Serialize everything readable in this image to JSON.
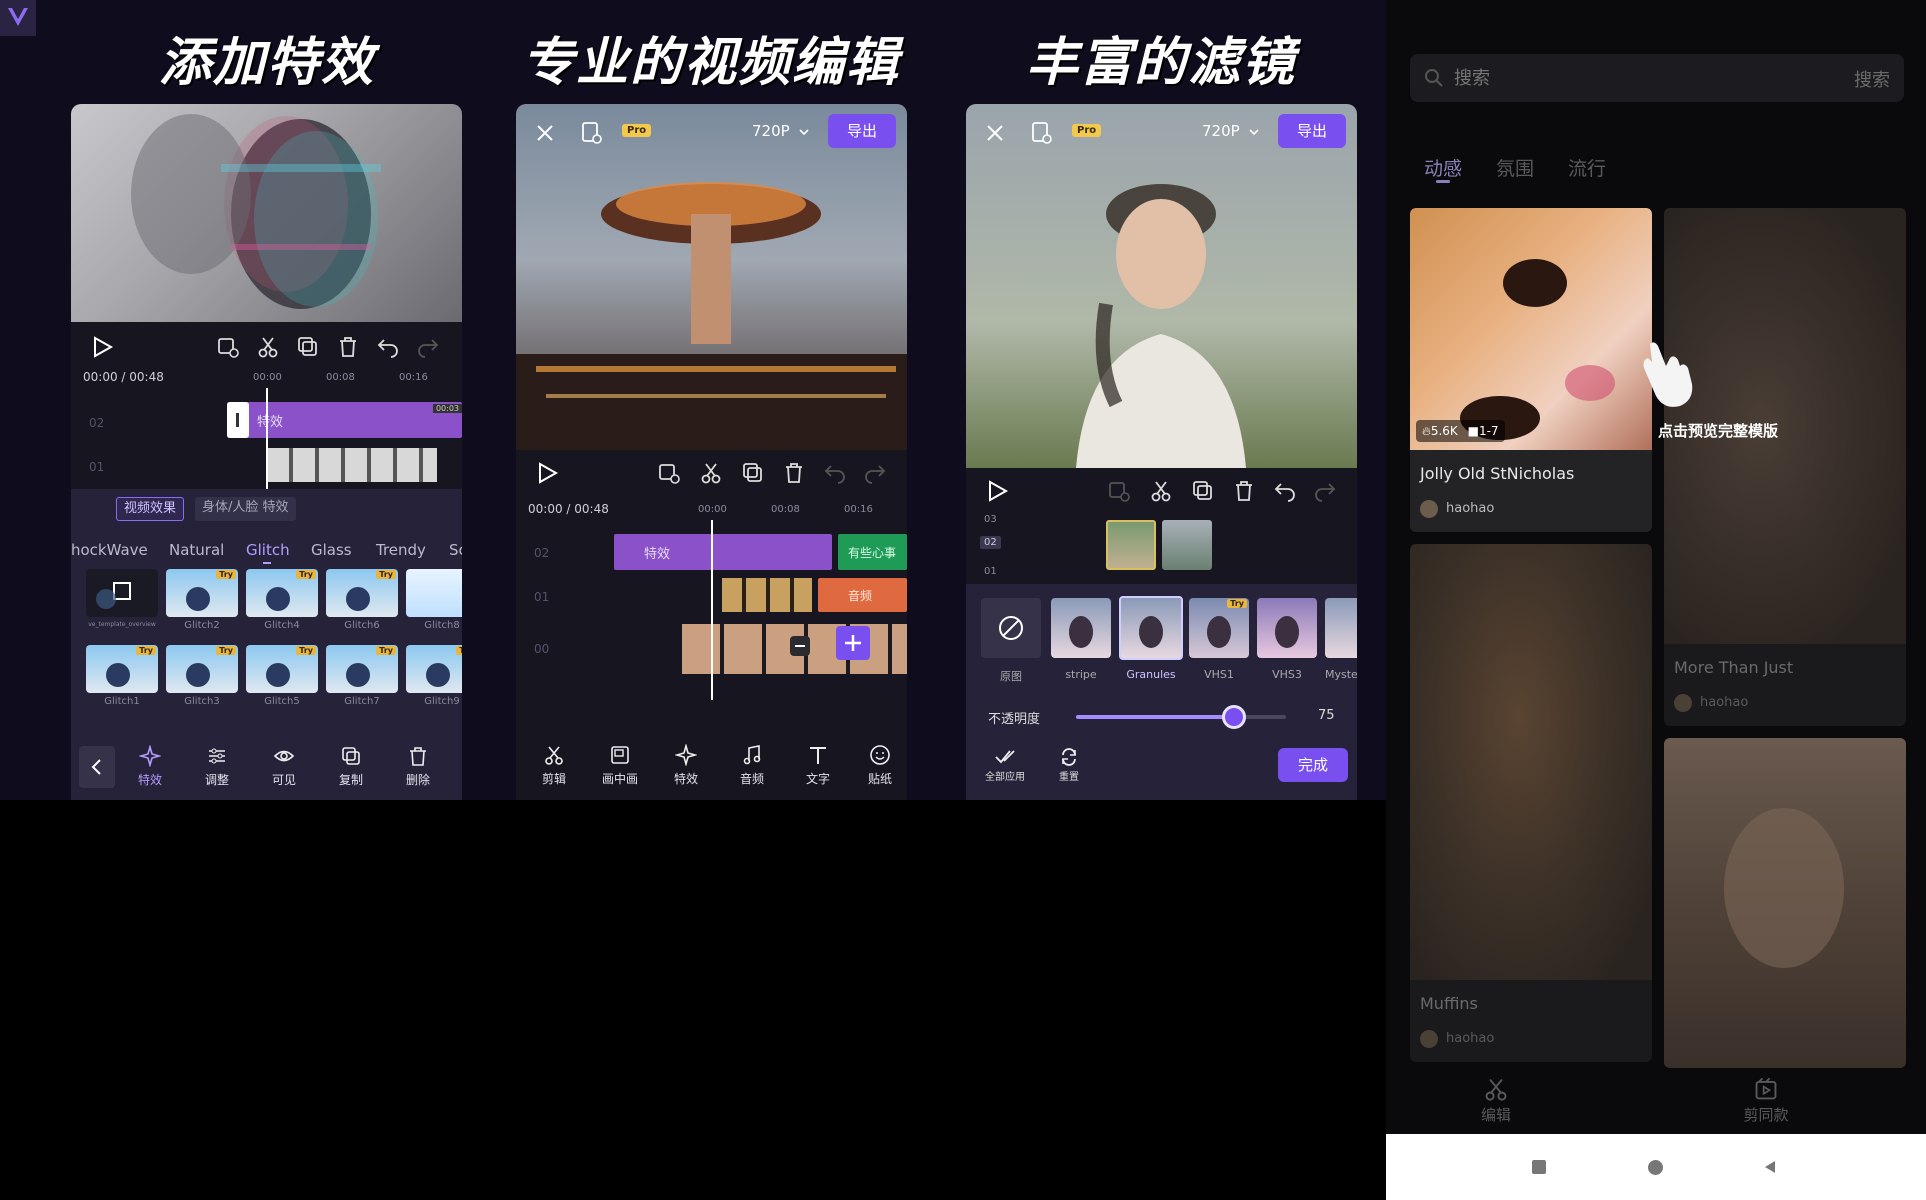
{
  "banner": {
    "titles": [
      "添加特效",
      "专业的视频编辑",
      "丰富的滤镜"
    ]
  },
  "phone1": {
    "time": "00:00 / 00:48",
    "ticks": [
      "00:00",
      "00:08",
      "00:16"
    ],
    "track_labels": [
      "02",
      "01"
    ],
    "effect_clip_label": "特效",
    "clip_duration_badge": "00:03",
    "filter_tabs": [
      "视频效果",
      "身体/人脸 特效"
    ],
    "categories": [
      "hockWave",
      "Natural",
      "Glitch",
      "Glass",
      "Trendy",
      "Sc"
    ],
    "active_category": "Glitch",
    "thumb_labels_row1": [
      "ve_template_overview",
      "Glitch2",
      "Glitch4",
      "Glitch6",
      "Glitch8"
    ],
    "thumb_labels_row2": [
      "Glitch1",
      "Glitch3",
      "Glitch5",
      "Glitch7",
      "Glitch9"
    ],
    "try_badge": "Try",
    "tools": [
      "特效",
      "调整",
      "可见",
      "复制",
      "删除"
    ]
  },
  "phone2": {
    "pro": "Pro",
    "resolution": "720P",
    "export": "导出",
    "time": "00:00 / 00:48",
    "ticks": [
      "00:00",
      "00:08",
      "00:16"
    ],
    "track_labels": [
      "02",
      "01",
      "00"
    ],
    "effect_clip_label": "特效",
    "text_clip_label": "有些心事",
    "audio_clip_label": "音频",
    "tools": [
      "剪辑",
      "画中画",
      "特效",
      "音频",
      "文字",
      "贴纸"
    ]
  },
  "phone3": {
    "pro": "Pro",
    "resolution": "720P",
    "export": "导出",
    "track_labels": [
      "03",
      "02",
      "01"
    ],
    "filters": [
      "原图",
      "stripe",
      "Granules",
      "VHS1",
      "VHS3",
      "Myste"
    ],
    "active_filter": "Granules",
    "try_badge": "Try",
    "opacity_label": "不透明度",
    "opacity_value": "75",
    "opacity_fraction": 0.75,
    "apply_all": "全部应用",
    "reset": "重置",
    "done": "完成"
  },
  "right": {
    "search_placeholder": "搜索",
    "search_button": "搜索",
    "tabs": [
      "动感",
      "氛围",
      "流行"
    ],
    "active_tab": "动感",
    "cards": [
      {
        "title": "Jolly Old StNicholas",
        "user": "haohao",
        "likes": "5.6K",
        "clips": "1-7"
      },
      {
        "title": "More Than Just",
        "user": "haohao"
      },
      {
        "title": "Muffins",
        "user": "haohao"
      },
      {
        "title": "",
        "user": ""
      }
    ],
    "tooltip": "点击预览完整模版",
    "bottom_nav": [
      "编辑",
      "剪同款"
    ]
  },
  "colors": {
    "accent": "#7a4ff0",
    "clip_purple": "#8a51c9",
    "clip_green": "#1f9a57",
    "clip_orange": "#e06a3f",
    "try_yellow": "#e7b63d"
  }
}
